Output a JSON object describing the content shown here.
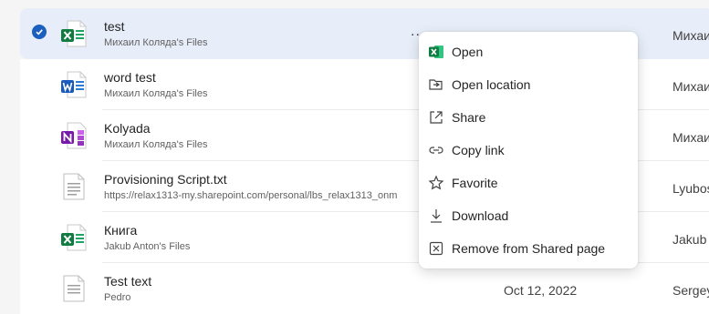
{
  "files": [
    {
      "name": "test",
      "location": "Михаил Коляда's Files",
      "date": "",
      "owner": "Михаил",
      "type": "excel",
      "selected": true
    },
    {
      "name": "word test",
      "location": "Михаил Коляда's Files",
      "date": "",
      "owner": "Михаил",
      "type": "word"
    },
    {
      "name": "Kolyada",
      "location": "Михаил Коляда's Files",
      "date": "",
      "owner": "Михаил",
      "type": "onenote"
    },
    {
      "name": "Provisioning Script.txt",
      "location": "https://relax1313-my.sharepoint.com/personal/lbs_relax1313_onm",
      "date": "",
      "owner": "Lyubos",
      "type": "text"
    },
    {
      "name": "Книга",
      "location": "Jakub Anton's Files",
      "date": "",
      "owner": "Jakub A",
      "type": "excel"
    },
    {
      "name": "Test text",
      "location": "Pedro",
      "date": "Oct 12, 2022",
      "owner": "Sergey",
      "type": "text"
    }
  ],
  "context_menu": {
    "items": [
      {
        "label": "Open",
        "icon": "excel-icon"
      },
      {
        "label": "Open location",
        "icon": "folder-location-icon"
      },
      {
        "label": "Share",
        "icon": "share-icon"
      },
      {
        "label": "Copy link",
        "icon": "link-icon"
      },
      {
        "label": "Favorite",
        "icon": "star-icon"
      },
      {
        "label": "Download",
        "icon": "download-icon"
      },
      {
        "label": "Remove from Shared page",
        "icon": "remove-icon"
      }
    ]
  },
  "row_actions": {
    "more": "..."
  },
  "colors": {
    "accent": "#1b5fbf",
    "excel": "#107c41",
    "word": "#185abd",
    "onenote": "#7719aa",
    "selected_row": "#e8eef9"
  }
}
